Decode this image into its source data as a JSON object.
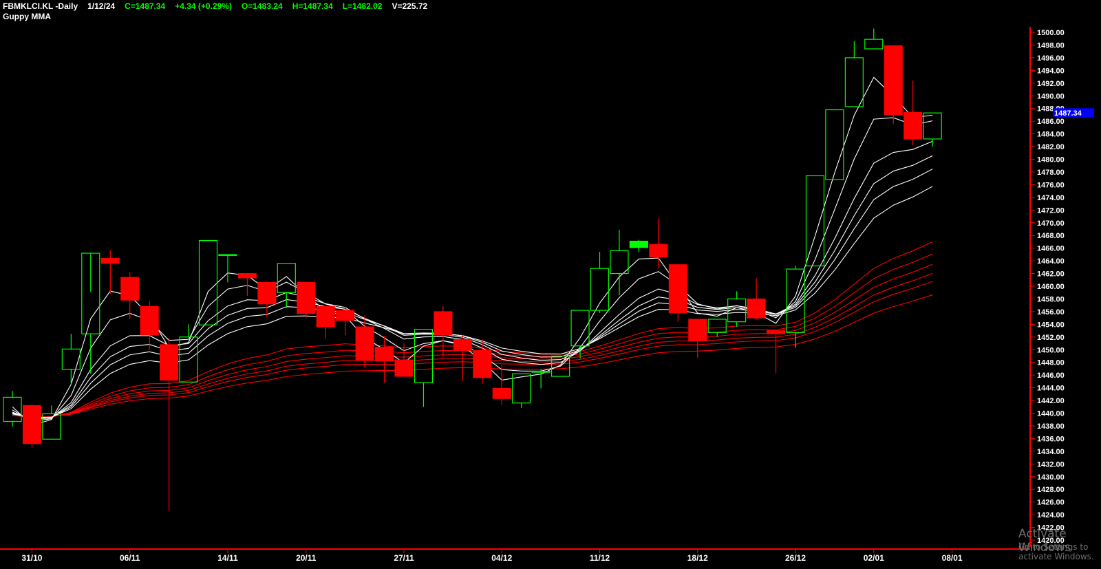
{
  "header": {
    "symbol": "FBMKLCI.KL -Daily",
    "date": "1/12/24",
    "close": "C=1487.34",
    "change": "+4.34 (+0.29%)",
    "open": "O=1483.24",
    "high": "H=1487.34",
    "low": "L=1482.02",
    "volume": "V=225.72"
  },
  "indicator_label": "Guppy MMA",
  "last_price_tag": "1487.34",
  "watermark": {
    "line1": "Activate Windows",
    "line2": "Go to Settings to activate Windows."
  },
  "colors": {
    "up": "#00ff00",
    "down": "#ff0000",
    "bullish_fill": "#00ff00",
    "short_mma": "#ffffff",
    "long_mma": "#ff0000",
    "price_tag": "#0000ff",
    "axis": "#ff0000",
    "background": "#000000"
  },
  "chart_data": {
    "type": "candlestick",
    "ylim": [
      1420,
      1500
    ],
    "yticks": [
      1420,
      1422,
      1424,
      1426,
      1428,
      1430,
      1432,
      1434,
      1436,
      1438,
      1440,
      1442,
      1444,
      1446,
      1448,
      1450,
      1452,
      1454,
      1456,
      1458,
      1460,
      1462,
      1464,
      1466,
      1468,
      1470,
      1472,
      1474,
      1476,
      1478,
      1480,
      1482,
      1484,
      1486,
      1488,
      1490,
      1492,
      1494,
      1496,
      1498,
      1500
    ],
    "xticks": [
      {
        "index": 1,
        "label": "31/10"
      },
      {
        "index": 6,
        "label": "06/11"
      },
      {
        "index": 11,
        "label": "14/11"
      },
      {
        "index": 15,
        "label": "20/11"
      },
      {
        "index": 20,
        "label": "27/11"
      },
      {
        "index": 25,
        "label": "04/12"
      },
      {
        "index": 30,
        "label": "11/12"
      },
      {
        "index": 35,
        "label": "18/12"
      },
      {
        "index": 40,
        "label": "26/12"
      },
      {
        "index": 44,
        "label": "02/01"
      },
      {
        "index": 48,
        "label": "08/01"
      }
    ],
    "candles": [
      {
        "o": 1438.7,
        "h": 1443.5,
        "l": 1437.9,
        "c": 1442.5
      },
      {
        "o": 1441.2,
        "h": 1441.4,
        "l": 1434.6,
        "c": 1435.2
      },
      {
        "o": 1435.9,
        "h": 1441.2,
        "l": 1435.9,
        "c": 1439.9
      },
      {
        "o": 1446.9,
        "h": 1452.5,
        "l": 1444.4,
        "c": 1450.1
      },
      {
        "o": 1452.5,
        "h": 1459.1,
        "l": 1446.2,
        "c": 1465.2
      },
      {
        "o": 1464.4,
        "h": 1465.7,
        "l": 1458.8,
        "c": 1463.6
      },
      {
        "o": 1461.4,
        "h": 1462.2,
        "l": 1454.8,
        "c": 1457.8
      },
      {
        "o": 1456.8,
        "h": 1457.7,
        "l": 1450.0,
        "c": 1452.3
      },
      {
        "o": 1450.8,
        "h": 1451.8,
        "l": 1424.6,
        "c": 1445.2
      },
      {
        "o": 1444.9,
        "h": 1454.0,
        "l": 1444.9,
        "c": 1452.0
      },
      {
        "o": 1453.9,
        "h": 1467.2,
        "l": 1453.9,
        "c": 1467.2
      },
      {
        "o": 1465.0,
        "h": 1465.0,
        "l": 1460.6,
        "c": 1465.0
      },
      {
        "o": 1462.0,
        "h": 1462.0,
        "l": 1458.5,
        "c": 1461.3
      },
      {
        "o": 1460.6,
        "h": 1460.6,
        "l": 1455.1,
        "c": 1457.2
      },
      {
        "o": 1459.0,
        "h": 1463.6,
        "l": 1456.6,
        "c": 1463.6
      },
      {
        "o": 1460.6,
        "h": 1460.6,
        "l": 1455.0,
        "c": 1455.7
      },
      {
        "o": 1456.8,
        "h": 1456.8,
        "l": 1451.8,
        "c": 1453.6
      },
      {
        "o": 1456.2,
        "h": 1456.8,
        "l": 1452.3,
        "c": 1454.6
      },
      {
        "o": 1453.6,
        "h": 1455.4,
        "l": 1447.2,
        "c": 1448.4
      },
      {
        "o": 1450.4,
        "h": 1452.2,
        "l": 1444.8,
        "c": 1448.2
      },
      {
        "o": 1448.4,
        "h": 1451.0,
        "l": 1445.8,
        "c": 1445.8
      },
      {
        "o": 1444.8,
        "h": 1453.2,
        "l": 1441.0,
        "c": 1453.2
      },
      {
        "o": 1456.0,
        "h": 1456.9,
        "l": 1448.8,
        "c": 1452.3
      },
      {
        "o": 1451.6,
        "h": 1452.3,
        "l": 1445.1,
        "c": 1449.9
      },
      {
        "o": 1449.9,
        "h": 1451.6,
        "l": 1444.6,
        "c": 1445.6
      },
      {
        "o": 1443.9,
        "h": 1447.6,
        "l": 1441.3,
        "c": 1442.3
      },
      {
        "o": 1441.6,
        "h": 1446.2,
        "l": 1440.8,
        "c": 1446.2
      },
      {
        "o": 1446.6,
        "h": 1446.9,
        "l": 1443.9,
        "c": 1446.6
      },
      {
        "o": 1445.8,
        "h": 1449.0,
        "l": 1445.8,
        "c": 1449.0
      },
      {
        "o": 1450.6,
        "h": 1456.2,
        "l": 1448.6,
        "c": 1456.2
      },
      {
        "o": 1456.2,
        "h": 1465.4,
        "l": 1455.8,
        "c": 1462.8
      },
      {
        "o": 1462.0,
        "h": 1468.9,
        "l": 1458.6,
        "c": 1465.6
      },
      {
        "o": 1466.1,
        "h": 1467.3,
        "l": 1465.4,
        "c": 1467.1
      },
      {
        "o": 1466.6,
        "h": 1470.7,
        "l": 1462.8,
        "c": 1464.6
      },
      {
        "o": 1463.4,
        "h": 1463.4,
        "l": 1454.4,
        "c": 1455.8
      },
      {
        "o": 1454.8,
        "h": 1454.8,
        "l": 1448.7,
        "c": 1451.4
      },
      {
        "o": 1452.7,
        "h": 1454.8,
        "l": 1452.0,
        "c": 1454.8
      },
      {
        "o": 1454.4,
        "h": 1459.2,
        "l": 1453.6,
        "c": 1458.0
      },
      {
        "o": 1458.0,
        "h": 1461.3,
        "l": 1454.8,
        "c": 1455.0
      },
      {
        "o": 1453.0,
        "h": 1453.0,
        "l": 1446.3,
        "c": 1452.5
      },
      {
        "o": 1452.7,
        "h": 1463.2,
        "l": 1450.3,
        "c": 1462.7
      },
      {
        "o": 1463.2,
        "h": 1477.4,
        "l": 1463.2,
        "c": 1477.4
      },
      {
        "o": 1476.8,
        "h": 1487.8,
        "l": 1476.8,
        "c": 1487.8
      },
      {
        "o": 1488.3,
        "h": 1498.6,
        "l": 1488.3,
        "c": 1496.0
      },
      {
        "o": 1497.4,
        "h": 1500.6,
        "l": 1497.4,
        "c": 1498.9
      },
      {
        "o": 1497.9,
        "h": 1497.9,
        "l": 1485.6,
        "c": 1487.0
      },
      {
        "o": 1487.4,
        "h": 1492.4,
        "l": 1482.2,
        "c": 1483.2
      },
      {
        "o": 1483.2,
        "h": 1487.3,
        "l": 1482.0,
        "c": 1487.3
      }
    ]
  }
}
